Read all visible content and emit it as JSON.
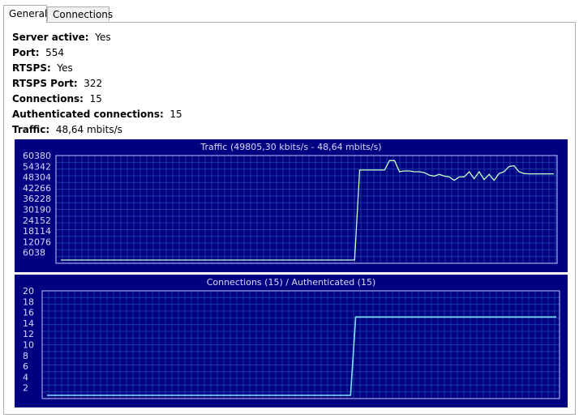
{
  "tabs": [
    {
      "label": "General",
      "active": true
    },
    {
      "label": "Connections",
      "active": false
    }
  ],
  "info": [
    {
      "label": "Server active:",
      "value": "Yes"
    },
    {
      "label": "Port:",
      "value": "554"
    },
    {
      "label": "RTSPS:",
      "value": "Yes"
    },
    {
      "label": "RTSPS Port:",
      "value": "322"
    },
    {
      "label": "Connections:",
      "value": "15"
    },
    {
      "label": "Authenticated connections:",
      "value": "15"
    },
    {
      "label": "Traffic:",
      "value": "48,64 mbits/s"
    }
  ],
  "colors": {
    "chart_bg": "#000080",
    "grid": "#1a3aa0",
    "frame": "#c8c8ff",
    "text": "#d8d8ff",
    "traffic_line": "#c8ffc8",
    "conn_line": "#80e0ff"
  },
  "chart_data": [
    {
      "type": "line",
      "title": "Traffic (49805,30 kbits/s - 48,64 mbits/s)",
      "yticks": [
        "60380",
        "54342",
        "48304",
        "42266",
        "36228",
        "30190",
        "24152",
        "18114",
        "12076",
        "6038"
      ],
      "ylim": [
        0,
        60380
      ],
      "x": [
        0,
        1,
        2,
        3,
        4,
        5,
        6,
        7,
        8,
        9,
        10,
        11,
        12,
        13,
        14,
        15,
        16,
        17,
        18,
        19,
        20,
        21,
        22,
        23,
        24,
        25,
        26,
        27,
        28,
        29,
        30,
        31,
        32,
        33,
        34,
        35,
        36,
        37,
        38,
        39,
        40,
        41,
        42,
        43,
        44,
        45,
        46,
        47,
        48,
        49,
        50,
        51,
        52,
        53,
        54,
        55,
        56,
        57,
        58,
        59,
        60,
        61,
        62,
        63,
        64,
        65,
        66,
        67,
        68,
        69,
        70,
        71,
        72,
        73,
        74,
        75,
        76,
        77,
        78,
        79,
        80,
        81,
        82,
        83,
        84,
        85,
        86,
        87,
        88,
        89,
        90,
        91,
        92,
        93,
        94,
        95,
        96,
        97,
        98,
        99
      ],
      "series": [
        {
          "values": [
            0,
            0,
            0,
            0,
            0,
            0,
            0,
            0,
            0,
            0,
            0,
            0,
            0,
            0,
            0,
            0,
            0,
            0,
            0,
            0,
            0,
            0,
            0,
            0,
            0,
            0,
            0,
            0,
            0,
            0,
            0,
            0,
            0,
            0,
            0,
            0,
            0,
            0,
            0,
            0,
            0,
            0,
            0,
            0,
            0,
            0,
            0,
            0,
            0,
            0,
            0,
            0,
            0,
            0,
            0,
            0,
            0,
            0,
            0,
            0,
            52000,
            52000,
            52000,
            52000,
            52000,
            52000,
            57500,
            57500,
            51000,
            51500,
            51500,
            51000,
            51000,
            50500,
            49000,
            48500,
            49500,
            48500,
            48000,
            46000,
            48000,
            48000,
            51000,
            47000,
            51000,
            46500,
            49500,
            46000,
            50000,
            51000,
            54000,
            54500,
            51000,
            50000,
            49805,
            49805,
            49805,
            49805,
            49805,
            49805
          ]
        }
      ]
    },
    {
      "type": "line",
      "title": "Connections (15) / Authenticated (15)",
      "yticks": [
        "20",
        "18",
        "16",
        "14",
        "12",
        "10",
        "8",
        "6",
        "4",
        "2"
      ],
      "ylim": [
        0,
        20
      ],
      "x": [
        0,
        1,
        2,
        3,
        4,
        5,
        6,
        7,
        8,
        9,
        10,
        11,
        12,
        13,
        14,
        15,
        16,
        17,
        18,
        19,
        20,
        21,
        22,
        23,
        24,
        25,
        26,
        27,
        28,
        29,
        30,
        31,
        32,
        33,
        34,
        35,
        36,
        37,
        38,
        39,
        40,
        41,
        42,
        43,
        44,
        45,
        46,
        47,
        48,
        49,
        50,
        51,
        52,
        53,
        54,
        55,
        56,
        57,
        58,
        59,
        60,
        61,
        62,
        63,
        64,
        65,
        66,
        67,
        68,
        69,
        70,
        71,
        72,
        73,
        74,
        75,
        76,
        77,
        78,
        79,
        80,
        81,
        82,
        83,
        84,
        85,
        86,
        87,
        88,
        89,
        90,
        91,
        92,
        93,
        94,
        95,
        96,
        97,
        98,
        99
      ],
      "series": [
        {
          "values": [
            0,
            0,
            0,
            0,
            0,
            0,
            0,
            0,
            0,
            0,
            0,
            0,
            0,
            0,
            0,
            0,
            0,
            0,
            0,
            0,
            0,
            0,
            0,
            0,
            0,
            0,
            0,
            0,
            0,
            0,
            0,
            0,
            0,
            0,
            0,
            0,
            0,
            0,
            0,
            0,
            0,
            0,
            0,
            0,
            0,
            0,
            0,
            0,
            0,
            0,
            0,
            0,
            0,
            0,
            0,
            0,
            0,
            0,
            0,
            0,
            15,
            15,
            15,
            15,
            15,
            15,
            15,
            15,
            15,
            15,
            15,
            15,
            15,
            15,
            15,
            15,
            15,
            15,
            15,
            15,
            15,
            15,
            15,
            15,
            15,
            15,
            15,
            15,
            15,
            15,
            15,
            15,
            15,
            15,
            15,
            15,
            15,
            15,
            15,
            15
          ]
        }
      ]
    }
  ]
}
